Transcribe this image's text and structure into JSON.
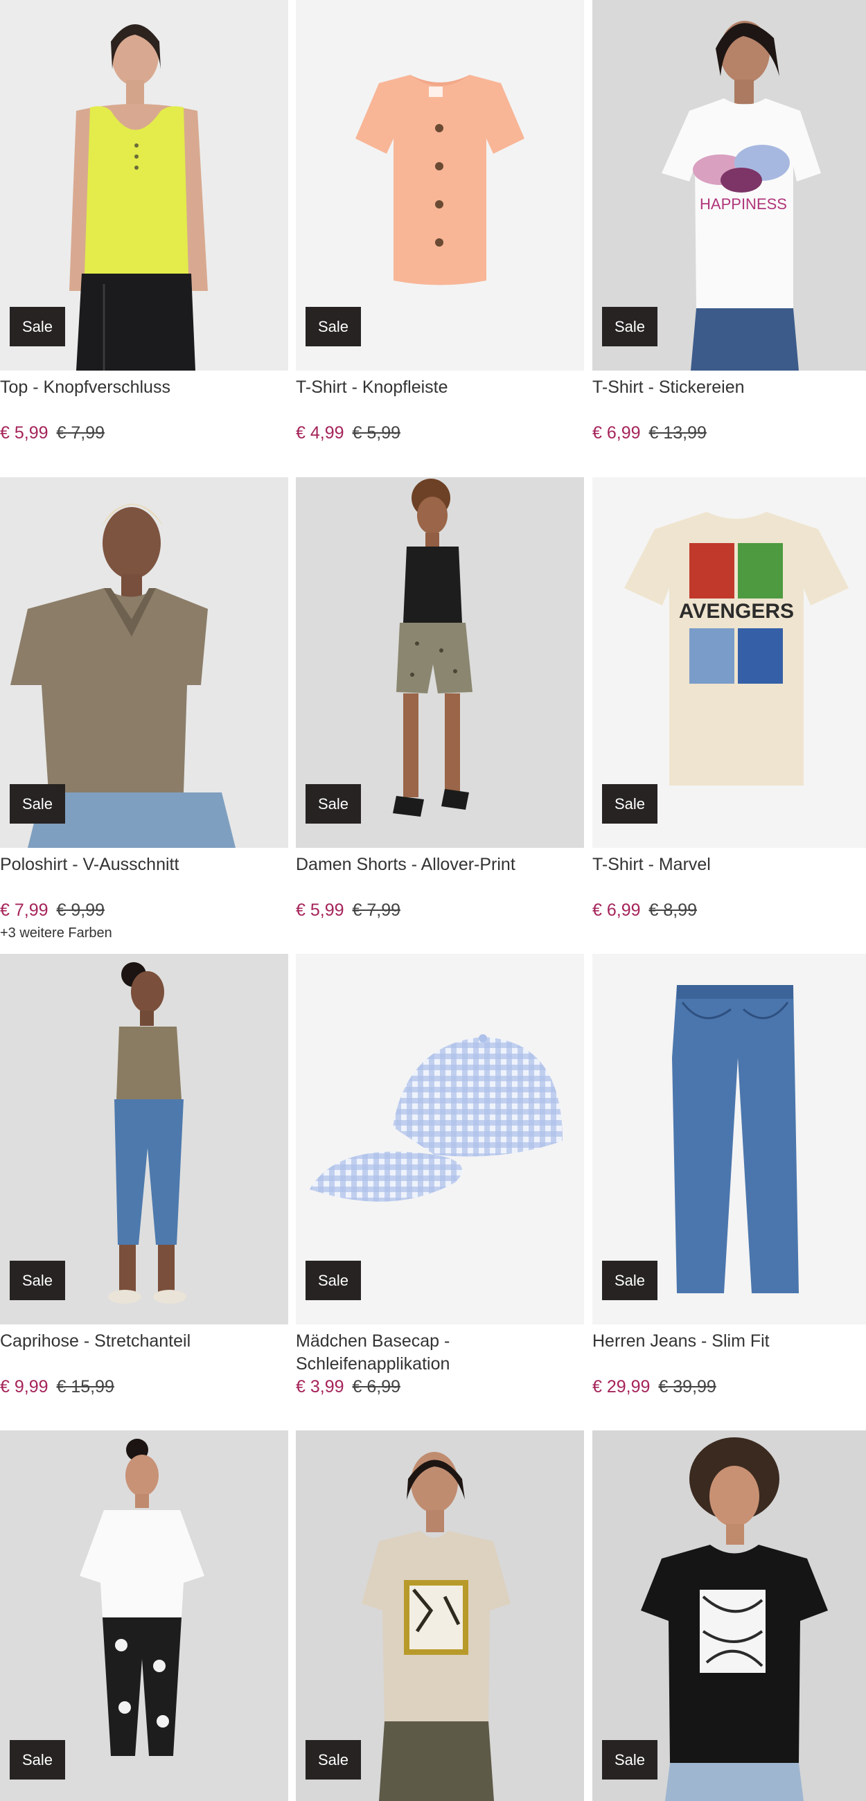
{
  "products": [
    {
      "title": "Top - Knopfverschluss",
      "price": "€ 5,99",
      "old_price": "€ 7,99",
      "badge": "Sale",
      "colors_note": ""
    },
    {
      "title": "T-Shirt - Knopfleiste",
      "price": "€ 4,99",
      "old_price": "€ 5,99",
      "badge": "Sale",
      "colors_note": ""
    },
    {
      "title": "T-Shirt - Stickereien",
      "price": "€ 6,99",
      "old_price": "€ 13,99",
      "badge": "Sale",
      "colors_note": ""
    },
    {
      "title": "Poloshirt - V-Ausschnitt",
      "price": "€ 7,99",
      "old_price": "€ 9,99",
      "badge": "Sale",
      "colors_note": "+3 weitere Farben"
    },
    {
      "title": "Damen Shorts - Allover-Print",
      "price": "€ 5,99",
      "old_price": "€ 7,99",
      "badge": "Sale",
      "colors_note": ""
    },
    {
      "title": "T-Shirt - Marvel",
      "price": "€ 6,99",
      "old_price": "€ 8,99",
      "badge": "Sale",
      "colors_note": ""
    },
    {
      "title": "Caprihose - Stretchanteil",
      "price": "€ 9,99",
      "old_price": "€ 15,99",
      "badge": "Sale",
      "colors_note": ""
    },
    {
      "title": "Mädchen Basecap - Schleifenapplikation",
      "price": "€ 3,99",
      "old_price": "€ 6,99",
      "badge": "Sale",
      "colors_note": ""
    },
    {
      "title": "Herren Jeans - Slim Fit",
      "price": "€ 29,99",
      "old_price": "€ 39,99",
      "badge": "Sale",
      "colors_note": ""
    },
    {
      "title": "",
      "price": "",
      "old_price": "",
      "badge": "Sale",
      "colors_note": ""
    },
    {
      "title": "",
      "price": "",
      "old_price": "",
      "badge": "Sale",
      "colors_note": ""
    },
    {
      "title": "",
      "price": "",
      "old_price": "",
      "badge": "Sale",
      "colors_note": ""
    }
  ],
  "photo_text": {
    "happiness": "HAPPINESS",
    "avengers": "AVENGERS"
  },
  "colors": {
    "sale_price": "#a5245a",
    "badge_bg": "#262322",
    "text": "#333333"
  },
  "icons": [
    "tank-top-yellow",
    "tshirt-peach",
    "tshirt-white-print",
    "polo-olive",
    "shorts-olive",
    "tshirt-avengers",
    "capri-jeans",
    "gingham-cap",
    "men-jeans",
    "tshirt-white-floral-pants",
    "tshirt-beige-zebra",
    "tshirt-black-print"
  ]
}
